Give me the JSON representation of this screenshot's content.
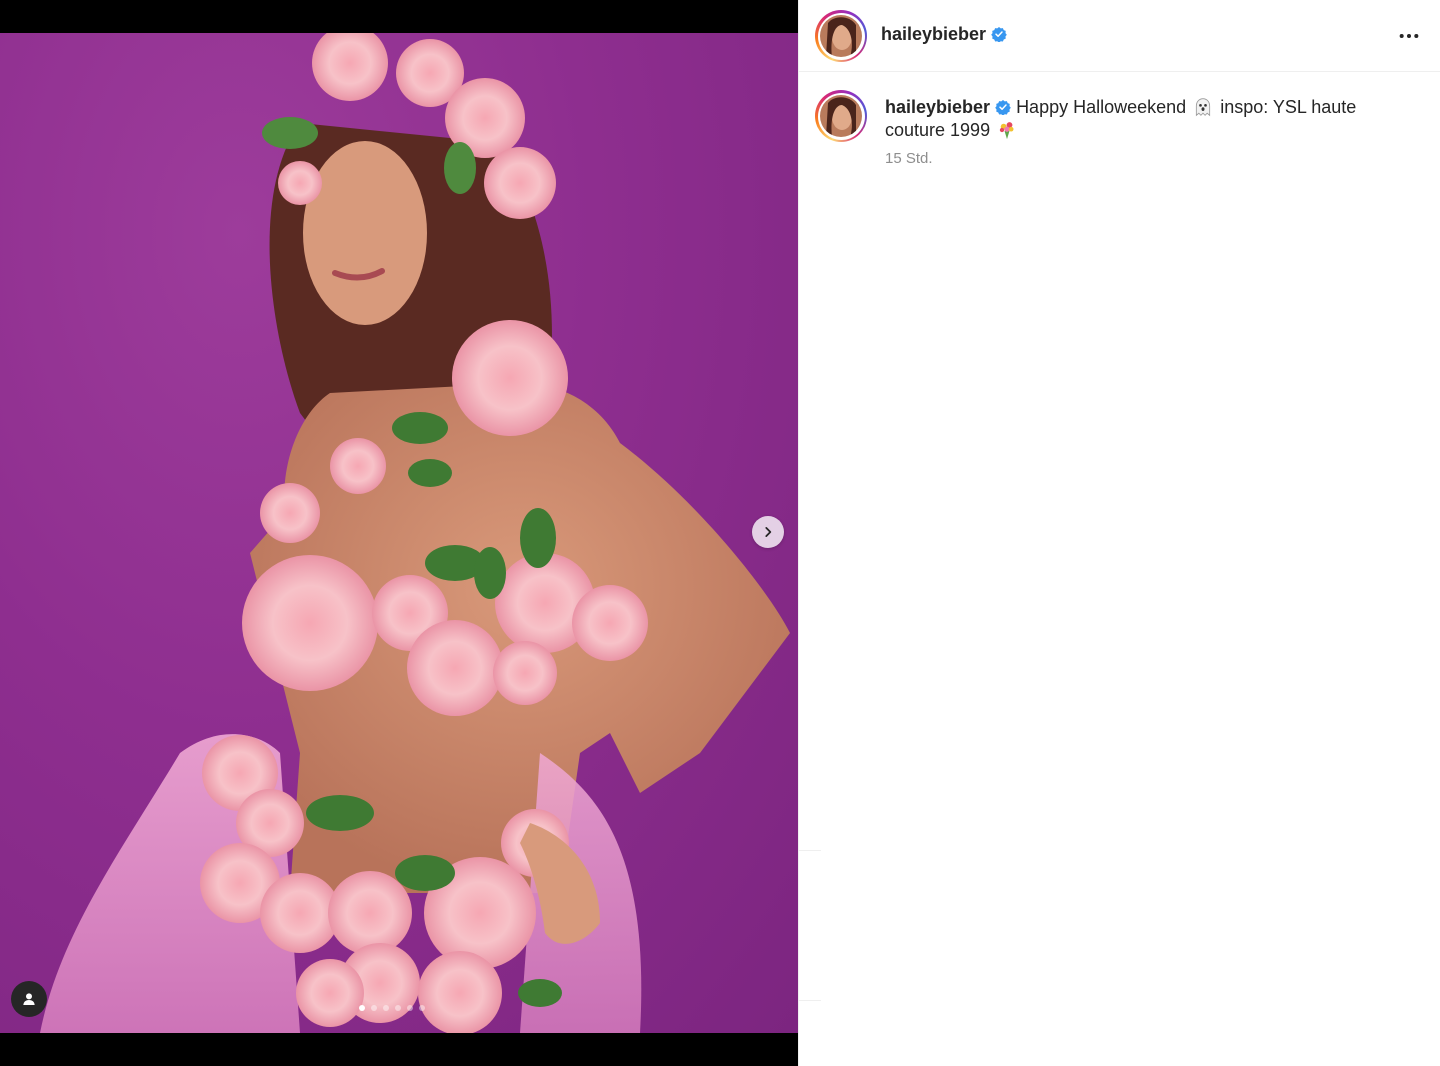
{
  "post": {
    "username": "haileybieber",
    "verified": true,
    "caption_text_1": "Happy Halloweekend",
    "caption_text_2": "inspo: YSL haute couture 1999",
    "timestamp": "15 Std.",
    "carousel": {
      "slide_count": 6,
      "active_index": 0
    }
  },
  "icons": {
    "verified": "verified-badge-icon",
    "more": "more-options-icon",
    "next": "chevron-right-icon",
    "tags": "user-tag-icon",
    "emoji_1": "ghost-emoji",
    "emoji_2": "bouquet-emoji"
  },
  "colors": {
    "background_purple": "#8e2e8f",
    "verified_blue": "#3897f0",
    "text_primary": "#262626",
    "text_secondary": "#8e8e8e"
  }
}
